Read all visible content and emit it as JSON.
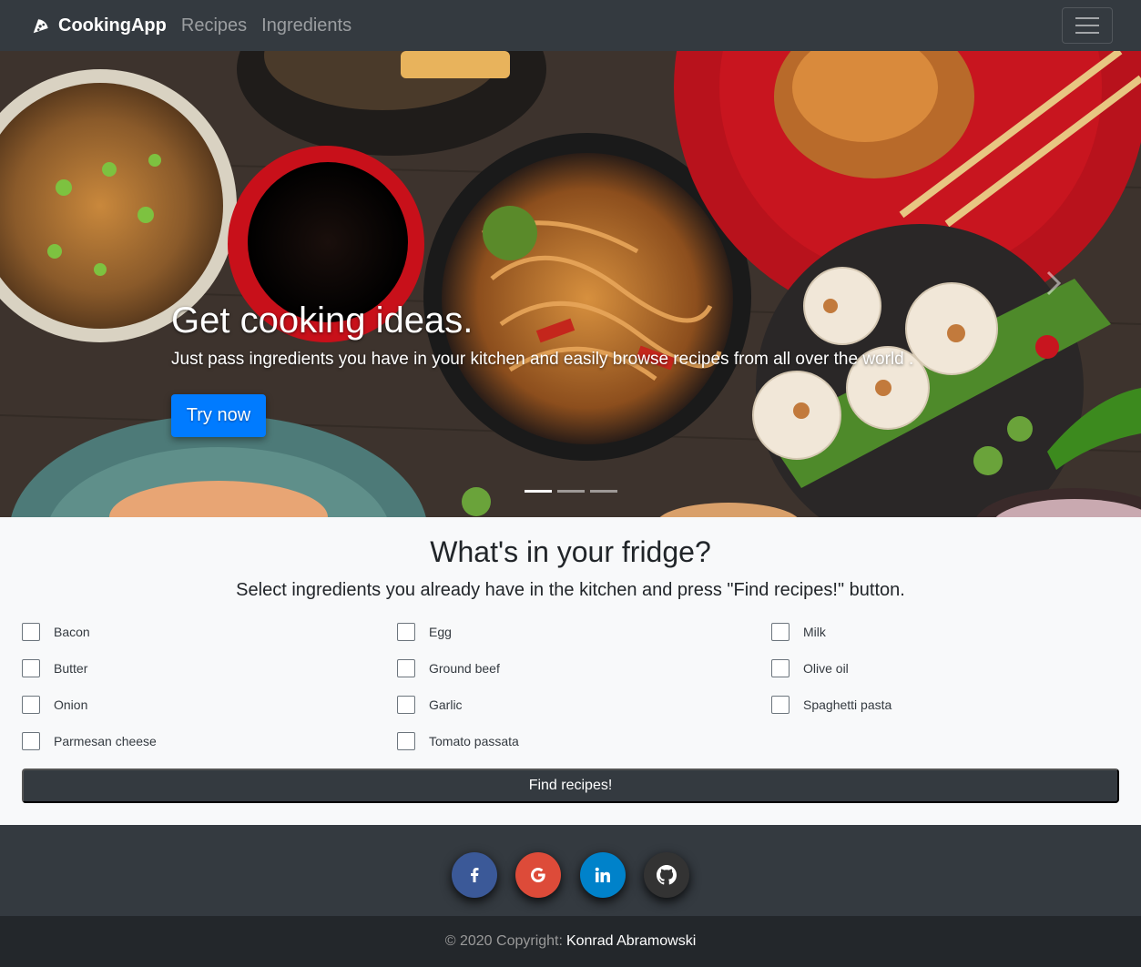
{
  "navbar": {
    "brand": "CookingApp",
    "links": [
      "Recipes",
      "Ingredients"
    ]
  },
  "carousel": {
    "heading": "Get cooking ideas.",
    "text": "Just pass ingredients you have in your kitchen and easily browse recipes from all over the world .",
    "button": "Try now",
    "slides_count": 3,
    "active_slide": 1
  },
  "fridge": {
    "title": "What's in your fridge?",
    "subtitle": "Select ingredients you already have in the kitchen and press \"Find recipes!\" button.",
    "ingredients": {
      "col1": [
        "Bacon",
        "Butter",
        "Onion",
        "Parmesan cheese"
      ],
      "col2": [
        "Egg",
        "Ground beef",
        "Garlic",
        "Tomato passata"
      ],
      "col3": [
        "Milk",
        "Olive oil",
        "Spaghetti pasta"
      ]
    },
    "button": "Find recipes!"
  },
  "footer": {
    "social": [
      {
        "icon": "facebook-icon",
        "color": "#3b5998"
      },
      {
        "icon": "google-icon",
        "color": "#dd4b39"
      },
      {
        "icon": "linkedin-icon",
        "color": "#0082ca"
      },
      {
        "icon": "github-icon",
        "color": "#333333"
      }
    ],
    "copyright": "© 2020 Copyright:",
    "author": "Konrad Abramowski"
  },
  "colors": {
    "navbar": "#343a40",
    "primary": "#007bff",
    "footer_bottom": "#23272b"
  }
}
